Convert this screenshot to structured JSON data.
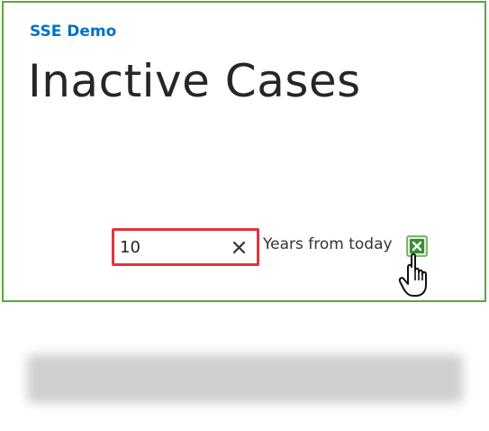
{
  "site": {
    "name": "SSE Demo"
  },
  "page": {
    "title": "Inactive Cases"
  },
  "filter": {
    "years_value": "10",
    "years_label": "Years from today",
    "clear_symbol": "✕"
  },
  "icons": {
    "clear": "close-icon",
    "export": "excel-icon",
    "cursor": "hand-pointer-icon"
  },
  "colors": {
    "panel_border": "#5aa83c",
    "site_link": "#0072c6",
    "highlight": "#e2343b",
    "excel_green": "#1e7e34"
  }
}
